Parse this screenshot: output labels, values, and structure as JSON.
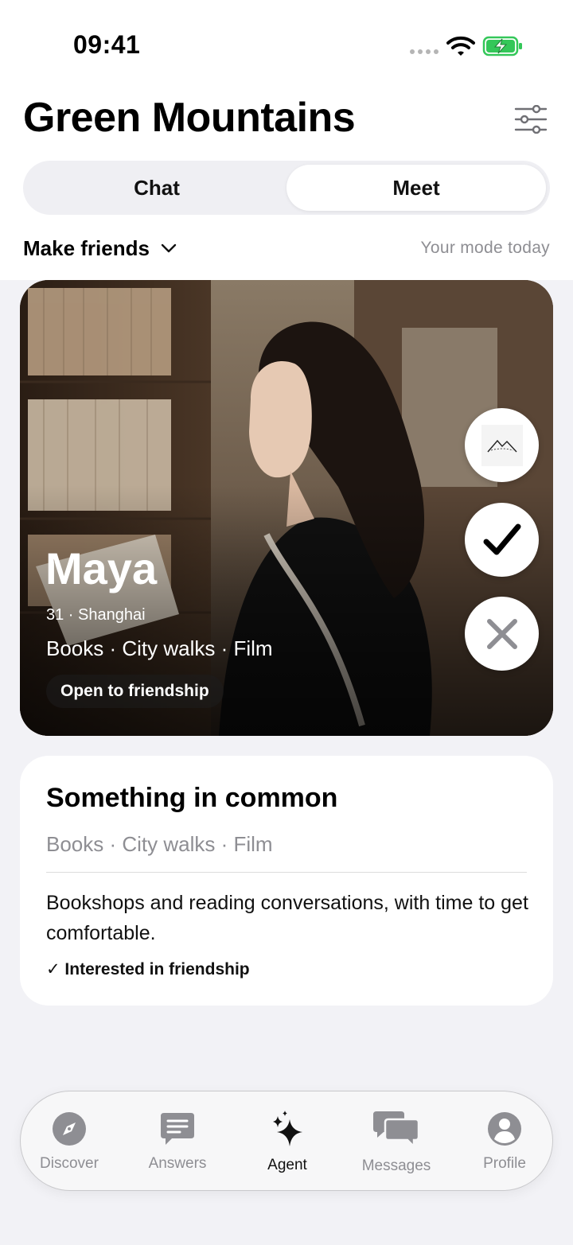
{
  "status_bar": {
    "time": "09:41"
  },
  "header": {
    "title": "Green Mountains"
  },
  "segments": {
    "chat": "Chat",
    "meet": "Meet",
    "selected": "Meet"
  },
  "mode": {
    "label": "Make friends",
    "hint": "Your mode today"
  },
  "profile": {
    "name": "Maya",
    "meta": "31 · Shanghai",
    "interests": "Books · City walks · Film",
    "badge": "Open to friendship"
  },
  "common": {
    "title": "Something in common",
    "interests": "Books · City walks · Film",
    "description": "Bookshops and reading conversations, with time to get comfortable.",
    "status": "✓ Interested in friendship"
  },
  "tabs": [
    {
      "label": "Discover",
      "icon": "compass-icon"
    },
    {
      "label": "Answers",
      "icon": "chat-bubble-lines-icon"
    },
    {
      "label": "Agent",
      "icon": "sparkles-icon",
      "active": true
    },
    {
      "label": "Messages",
      "icon": "messages-bubbles-icon"
    },
    {
      "label": "Profile",
      "icon": "person-circle-icon"
    }
  ],
  "colors": {
    "background": "#f2f2f6",
    "card": "#ffffff",
    "battery": "#34c759",
    "muted_text": "#8e8e93"
  }
}
